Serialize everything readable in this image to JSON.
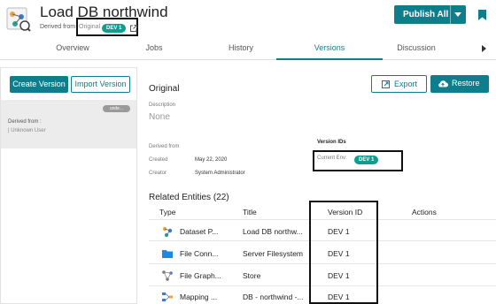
{
  "header": {
    "title": "Load DB northwind",
    "derived_label": "Derived from",
    "derived_value": "Original",
    "derived_badge": "DEV 1",
    "publish_label": "Publish All"
  },
  "tabs": [
    {
      "label": "Overview"
    },
    {
      "label": "Jobs"
    },
    {
      "label": "History"
    },
    {
      "label": "Versions",
      "active": true
    },
    {
      "label": "Discussion"
    }
  ],
  "left_panel": {
    "create_label": "Create Version",
    "import_label": "Import Version",
    "item": {
      "pill": "unde...",
      "derived_label": "Derived from :",
      "user": "| Unknown User"
    }
  },
  "detail": {
    "heading": "Original",
    "export_label": "Export",
    "restore_label": "Restore",
    "description_label": "Description",
    "description_value": "None",
    "derived_from_label": "Derived from",
    "created_label": "Created",
    "created_value": "May 22, 2020",
    "creator_label": "Creator",
    "creator_value": "System Administrator",
    "version_ids_heading": "Version IDs",
    "current_env_label": "Current Env:",
    "current_env_badge": "DEV 1"
  },
  "related": {
    "heading": "Related Entities (22)",
    "columns": [
      "Type",
      "Title",
      "Version ID",
      "Actions"
    ],
    "rows": [
      {
        "type": "Dataset P...",
        "title": "Load DB northw...",
        "version": "DEV 1",
        "icon": "dataset-icon"
      },
      {
        "type": "File Conn...",
        "title": "Server Filesystem",
        "version": "DEV 1",
        "icon": "folder-icon"
      },
      {
        "type": "File Graph...",
        "title": "Store",
        "version": "DEV 1",
        "icon": "graph-icon"
      },
      {
        "type": "Mapping ...",
        "title": "DB - northwind -...",
        "version": "DEV 1",
        "icon": "mapping-icon"
      }
    ]
  },
  "colors": {
    "accent": "#0f7e8c",
    "badge": "#0f9d8e"
  }
}
